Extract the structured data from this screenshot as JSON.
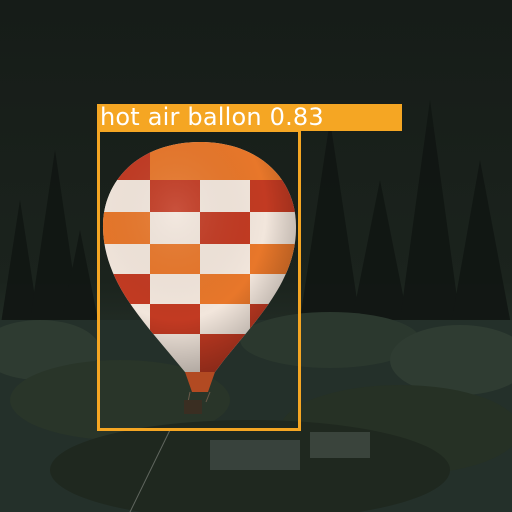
{
  "detections": [
    {
      "label": "hot air ballon 0.83",
      "class_name": "hot air ballon",
      "score": 0.83,
      "box_color": "#f5a623"
    }
  ],
  "scene": {
    "subject": "hot-air-balloon",
    "balloon_colors": [
      "#c23a22",
      "#e8772a",
      "#f2e6dc"
    ],
    "background_colors": [
      "#141a16",
      "#1f2a22",
      "#2d3a2e"
    ]
  }
}
